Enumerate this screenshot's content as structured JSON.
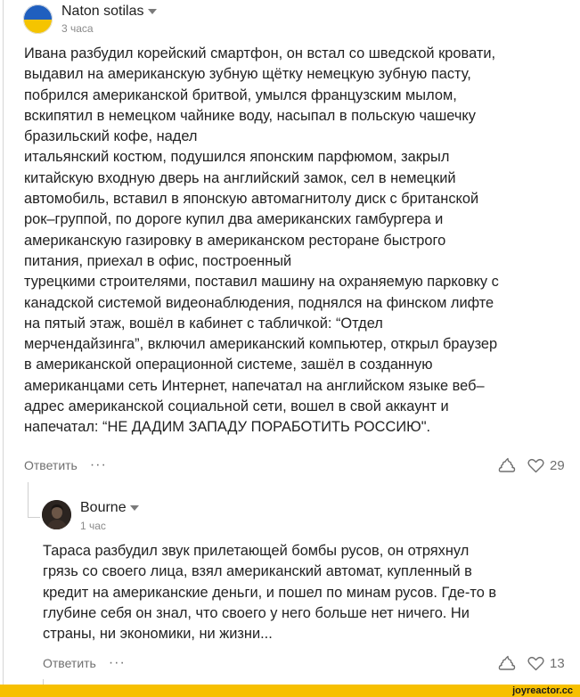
{
  "comments": [
    {
      "author": "Naton sotilas",
      "time": "3 часа",
      "text": "Ивана разбудил корейский смартфон, он встал со шведской кровати,\nвыдавил на американскую зубную щётку немецкую зубную пасту,\nпобрился американской бритвой, умылся французским мылом,\nвскипятил в немецком чайнике воду, насыпал в польскую чашечку\nбразильский кофе, надел\nитальянский костюм, подушился японским парфюмом, закрыл\nкитайскую входную дверь на английский замок, сел в немецкий\nавтомобиль, вставил в японскую автомагнитолу диск с британской\nрок–группой, по дороге купил два американских гамбургера и\nамериканскую газировку в американском ресторане быстрого\nпитания, приехал в офис, построенный\nтурецкими строителями, поставил машину на охраняемую парковку с\nканадской системой видеонаблюдения, поднялся на финском лифте\nна пятый этаж, вошёл в кабинет с табличкой: “Отдел\nмерчендайзинга”, включил американский компьютер, открыл браузер\nв американской операционной системе, зашёл в созданную\nамериканцами сеть Интернет, напечатал на английском языке веб–\nадрес американской социальной сети, вошел в свой аккаунт и\nнапечатал: “НЕ ДАДИМ ЗАПАДУ ПОРАБОТИТЬ РОССИЮ\".",
      "reply_label": "Ответить",
      "more_label": "···",
      "likes": "29",
      "avatar_icon": "ukraine-flag-avatar"
    },
    {
      "author": "Bourne",
      "time": "1 час",
      "text": "Тараса разбудил звук прилетающей бомбы русов, он отряхнул\nгрязь со своего лица, взял американский автомат, купленный в\nкредит на американские деньги, и пошел по минам русов. Где-то в\nглубине себя он знал, что своего у него больше нет ничего. Ни\nстраны, ни экономики, ни жизни...",
      "reply_label": "Ответить",
      "more_label": "···",
      "likes": "13",
      "avatar_icon": "user-photo-avatar"
    }
  ],
  "footer": {
    "site": "joyreactor.cc"
  },
  "colors": {
    "footer_bg": "#f7c000",
    "flag_blue": "#1f5fbf",
    "flag_yellow": "#f5c400"
  }
}
